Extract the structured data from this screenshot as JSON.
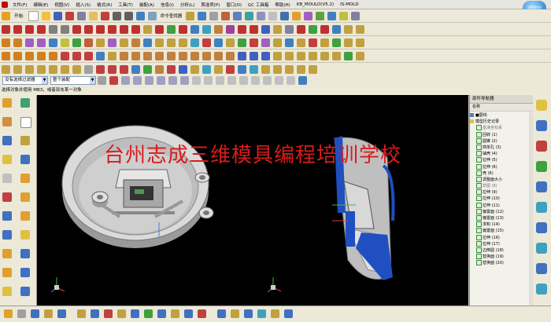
{
  "menubar": {
    "items": [
      "文件(F)",
      "编辑(E)",
      "视图(V)",
      "插入(S)",
      "格式(R)",
      "工具(T)",
      "装配(A)",
      "信息(I)",
      "分析(L)",
      "首选项(P)",
      "窗口(O)",
      "GC 工具箱",
      "帮助(H)",
      "KB_MOULD(V5.2)",
      "IS-MOLD"
    ]
  },
  "toolbar1": {
    "start_label": "开始·",
    "shortcut_label": "命令查找器"
  },
  "selection": {
    "filter_value": "没有选择过滤器",
    "scope_value": "整个装配"
  },
  "status": {
    "text": "选择对象并使用 MB3，或者双击某一对象"
  },
  "watermark": {
    "text": "台州志成三维模具编程培训学校"
  },
  "navigator": {
    "title": "部件导航器",
    "header": "名称",
    "items": [
      "■图线",
      "模型历史记录",
      "基准坐标系",
      "回转 (1)",
      "圆锥 (2)",
      "简单孔 (3)",
      "抽壳 (4)",
      "拉伸 (5)",
      "拉伸 (6)",
      "壳 (6)",
      "调整面大小",
      "草图 (8)",
      "拉伸 (9)",
      "拉伸 (10)",
      "拉伸 (11)",
      "偏置面 (12)",
      "偏置面 (13)",
      "求和 (14)",
      "偏置面 (15)",
      "拉伸 (16)",
      "拉伸 (17)",
      "边倒圆 (18)",
      "替换面 (19)",
      "替换面 (20)"
    ]
  },
  "colors": {
    "viewport": "#000000",
    "watermark": "#d81b1b",
    "part": "#dcdcdc",
    "section": "#1f4fc0"
  }
}
